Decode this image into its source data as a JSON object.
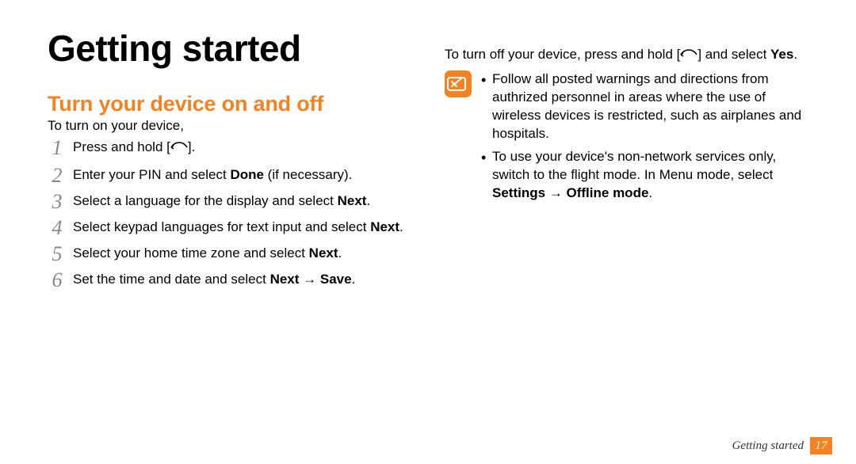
{
  "heading": "Getting started",
  "section_title": "Turn your device on and off",
  "intro": "To turn on your device,",
  "steps": {
    "s1_pre": "Press and hold [",
    "s1_post": "].",
    "s2_a": "Enter your PIN and select ",
    "s2_b": "Done",
    "s2_c": " (if necessary).",
    "s3_a": "Select a language for the display and select ",
    "s3_b": "Next",
    "s3_c": ".",
    "s4_a": "Select keypad languages for text input and select ",
    "s4_b": "Next",
    "s4_c": ".",
    "s5_a": "Select your home time zone and select ",
    "s5_b": "Next",
    "s5_c": ".",
    "s6_a": "Set the time and date and select ",
    "s6_b": "Next",
    "s6_arrow": " → ",
    "s6_c": "Save",
    "s6_d": "."
  },
  "turnoff": {
    "pre": "To turn off your device, press and hold [",
    "post": "] and select ",
    "yes": "Yes",
    "end": "."
  },
  "notes": {
    "n1": "Follow all posted warnings and directions from authrized personnel in areas where the use of wireless devices is restricted, such as airplanes and hospitals.",
    "n2_a": "To use your device's non-network services only, switch to the flight mode. In Menu mode, select ",
    "n2_b": "Settings",
    "n2_arrow": " → ",
    "n2_c": "Offline mode",
    "n2_d": "."
  },
  "footer": {
    "section": "Getting started",
    "page": "17"
  },
  "colors": {
    "accent": "#f58220"
  }
}
